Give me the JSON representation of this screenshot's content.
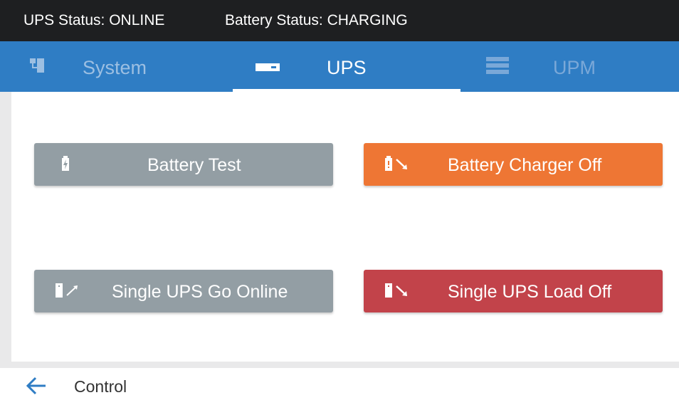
{
  "status_bar": {
    "ups_status": "UPS Status: ONLINE",
    "battery_status": "Battery Status: CHARGING"
  },
  "nav": {
    "tabs": [
      {
        "label": "System",
        "icon": "system-hierarchy-icon",
        "active": false
      },
      {
        "label": "UPS",
        "icon": "ups-bar-icon",
        "active": true
      },
      {
        "label": "UPM",
        "icon": "upm-stack-icon",
        "active": false
      }
    ]
  },
  "buttons": [
    {
      "label": "Battery Test",
      "icon": "battery-test-icon",
      "color": "#939ea4"
    },
    {
      "label": "Battery Charger Off",
      "icon": "battery-charger-off-icon",
      "color": "#ee7634"
    },
    {
      "label": "Single UPS Go Online",
      "icon": "ups-go-online-icon",
      "color": "#939ea4"
    },
    {
      "label": "Single UPS Load Off",
      "icon": "ups-load-off-icon",
      "color": "#c2434a"
    }
  ],
  "footer": {
    "back_icon": "arrow-left-icon",
    "title": "Control"
  },
  "colors": {
    "status_bar": "#1e1f21",
    "nav_bar": "#2f7dc4",
    "accent_blue": "#2f7dc4"
  }
}
